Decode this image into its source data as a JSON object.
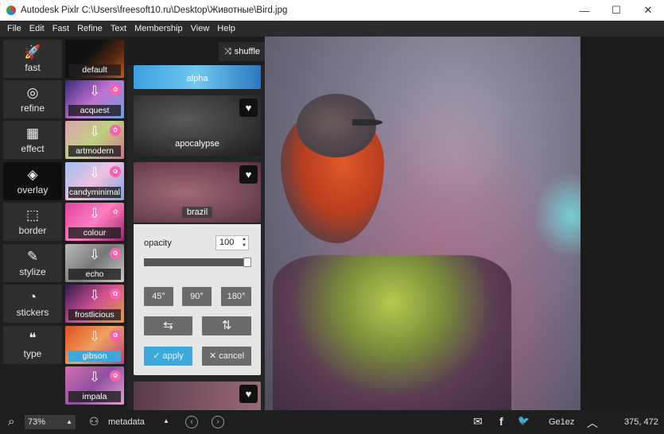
{
  "window": {
    "title": "Autodesk Pixlr   C:\\Users\\freesoft10.ru\\Desktop\\Животные\\Bird.jpg",
    "minimize_glyph": "—",
    "maximize_glyph": "☐",
    "close_glyph": "✕"
  },
  "menu": [
    "File",
    "Edit",
    "Fast",
    "Refine",
    "Text",
    "Membership",
    "View",
    "Help"
  ],
  "tools": [
    {
      "label": "fast",
      "icon": "rocket-icon",
      "glyph": "🚀"
    },
    {
      "label": "refine",
      "icon": "refine-icon",
      "glyph": "◎"
    },
    {
      "label": "effect",
      "icon": "film-icon",
      "glyph": "▦"
    },
    {
      "label": "overlay",
      "icon": "layers-icon",
      "glyph": "◈"
    },
    {
      "label": "border",
      "icon": "border-icon",
      "glyph": "⬚"
    },
    {
      "label": "stylize",
      "icon": "brush-icon",
      "glyph": "✎"
    },
    {
      "label": "stickers",
      "icon": "sticker-icon",
      "glyph": "◔"
    },
    {
      "label": "type",
      "icon": "quote-icon",
      "glyph": "❝"
    }
  ],
  "active_tool": "overlay",
  "presets": [
    "default",
    "acquest",
    "artmodern",
    "candyminimal",
    "colour",
    "echo",
    "frostlicious",
    "gibson",
    "impala"
  ],
  "selected_preset": "gibson",
  "download_glyph": "⇩",
  "gift_glyph": "✿",
  "shuffle": {
    "label": "shuffle",
    "glyph": "⤨"
  },
  "overlays": [
    "alpha",
    "apocalypse",
    "brazil"
  ],
  "heart_glyph": "♥",
  "settings": {
    "opacity_label": "opacity",
    "opacity_value": "100",
    "opacity_level": 1.0,
    "rotate_buttons": [
      "45°",
      "90°",
      "180°"
    ],
    "flip_h_glyph": "⇆",
    "flip_v_glyph": "⇅",
    "apply_label": "apply",
    "apply_glyph": "✓",
    "cancel_label": "cancel",
    "cancel_glyph": "✕"
  },
  "status": {
    "zoom": "73%",
    "metadata_label": "metadata",
    "username": "Ge1ez",
    "coords": "375, 472",
    "search_glyph": "⌕",
    "up_glyph": "▲",
    "prev_glyph": "‹",
    "next_glyph": "›",
    "mail_glyph": "✉",
    "facebook_glyph": "f",
    "twitter_glyph": "🐦",
    "expand_glyph": "︿"
  },
  "colors": {
    "accent": "#3aa9dd",
    "gift": "#ff5fae"
  }
}
